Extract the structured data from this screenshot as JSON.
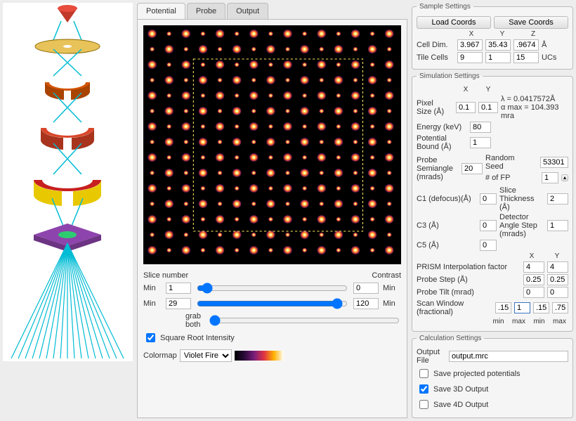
{
  "tabs": {
    "potential": "Potential",
    "probe": "Probe",
    "output": "Output"
  },
  "slice": {
    "number_label": "Slice number",
    "contrast_label": "Contrast",
    "min_label": "Min",
    "min1_val": "1",
    "cmin_val": "0",
    "min2_val": "29",
    "cmax_val": "120",
    "grab_both": "grab both",
    "sqrt": "Square Root Intensity"
  },
  "colormap": {
    "label": "Colormap",
    "value": "Violet Fire"
  },
  "sample": {
    "legend": "Sample Settings",
    "load": "Load Coords",
    "save": "Save Coords",
    "X": "X",
    "Y": "Y",
    "Z": "Z",
    "celldim": "Cell Dim.",
    "cx": "3.967",
    "cy": "35.43",
    "cz": ".9674",
    "unitA": "Å",
    "tilecells": "Tile Cells",
    "tx": "9",
    "ty": "1",
    "tz": "15",
    "unitUC": "UCs"
  },
  "sim": {
    "legend": "Simulation Settings",
    "X": "X",
    "Y": "Y",
    "pixel_size": "Pixel\nSize (Å)",
    "px": "0.1",
    "py": "0.1",
    "lambda": "λ = 0.0417572Å",
    "alpha": "α max = 104.393 mra",
    "energy": "Energy (keV)",
    "energy_val": "80",
    "potbound": "Potential\nBound (Å)",
    "potbound_val": "1",
    "semiangle": "Probe\nSemiangle\n(mrads)",
    "semiangle_val": "20",
    "randseed": "Random Seed",
    "randseed_val": "53301",
    "fp": "# of FP",
    "fp_val": "1",
    "slicethick": "Slice\nThickness (Å)",
    "slicethick_val": "2",
    "c1": "C1 (defocus)(Å)",
    "c1_val": "0",
    "c3": "C3 (Å)",
    "c3_val": "0",
    "c5": "C5 (Å)",
    "c5_val": "0",
    "detstep": "Detector\nAngle Step\n(mrads)",
    "detstep_val": "1",
    "prism": "PRISM Interpolation factor",
    "prism_x": "4",
    "prism_y": "4",
    "probestep": "Probe Step (Å)",
    "ps_x": "0.25",
    "ps_y": "0.25",
    "probetilt": "Probe Tilt (mrad)",
    "pt_x": "0",
    "pt_y": "0",
    "scanwin": "Scan Window (fractional)",
    "sw_xmin": ".15",
    "sw_xmax": "1",
    "sw_ymin": ".15",
    "sw_ymax": ".75",
    "min": "min",
    "max": "max"
  },
  "calc": {
    "legend": "Calculation Settings",
    "outfile": "Output File",
    "outfile_val": "output.mrc",
    "save_pot": "Save projected potentials",
    "save_3d": "Save 3D Output",
    "save_4d": "Save 4D Output"
  }
}
